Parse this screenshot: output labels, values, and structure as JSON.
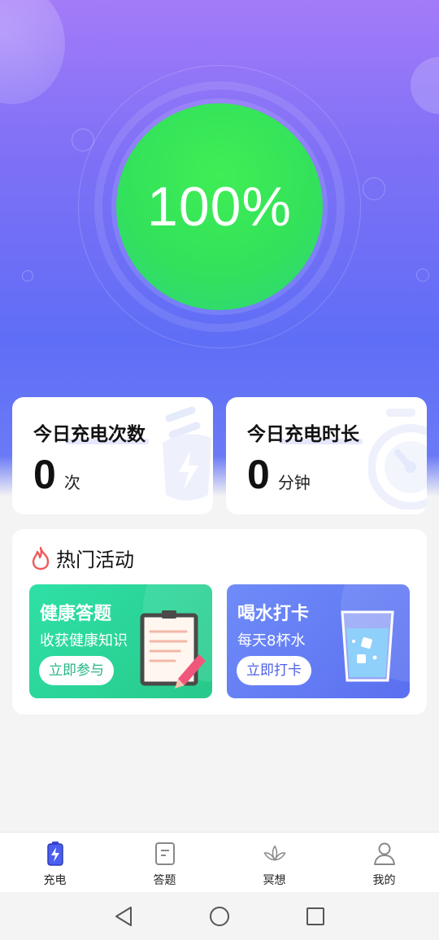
{
  "battery": {
    "percent_label": "100%",
    "percent": 100
  },
  "stats": [
    {
      "title": "今日充电次数",
      "value": "0",
      "unit": "次",
      "icon": "charger-plug-icon"
    },
    {
      "title": "今日充电时长",
      "value": "0",
      "unit": "分钟",
      "icon": "stopwatch-icon"
    }
  ],
  "hot": {
    "title": "热门活动",
    "icon": "flame-icon",
    "activities": [
      {
        "title": "健康答题",
        "subtitle": "收获健康知识",
        "button": "立即参与",
        "icon": "clipboard-pencil-icon"
      },
      {
        "title": "喝水打卡",
        "subtitle": "每天8杯水",
        "button": "立即打卡",
        "icon": "water-glass-icon"
      }
    ]
  },
  "nav": [
    {
      "label": "充电",
      "icon": "battery-icon",
      "active": true
    },
    {
      "label": "答题",
      "icon": "document-icon"
    },
    {
      "label": "冥想",
      "icon": "lotus-icon"
    },
    {
      "label": "我的",
      "icon": "person-icon"
    }
  ],
  "system_nav": [
    "back-triangle-icon",
    "home-circle-icon",
    "recents-square-icon"
  ],
  "colors": {
    "accent": "#5f6ef6",
    "battery_green": "#33e25a",
    "quiz_green": "#27c98a",
    "water_blue": "#5a6ff0"
  }
}
